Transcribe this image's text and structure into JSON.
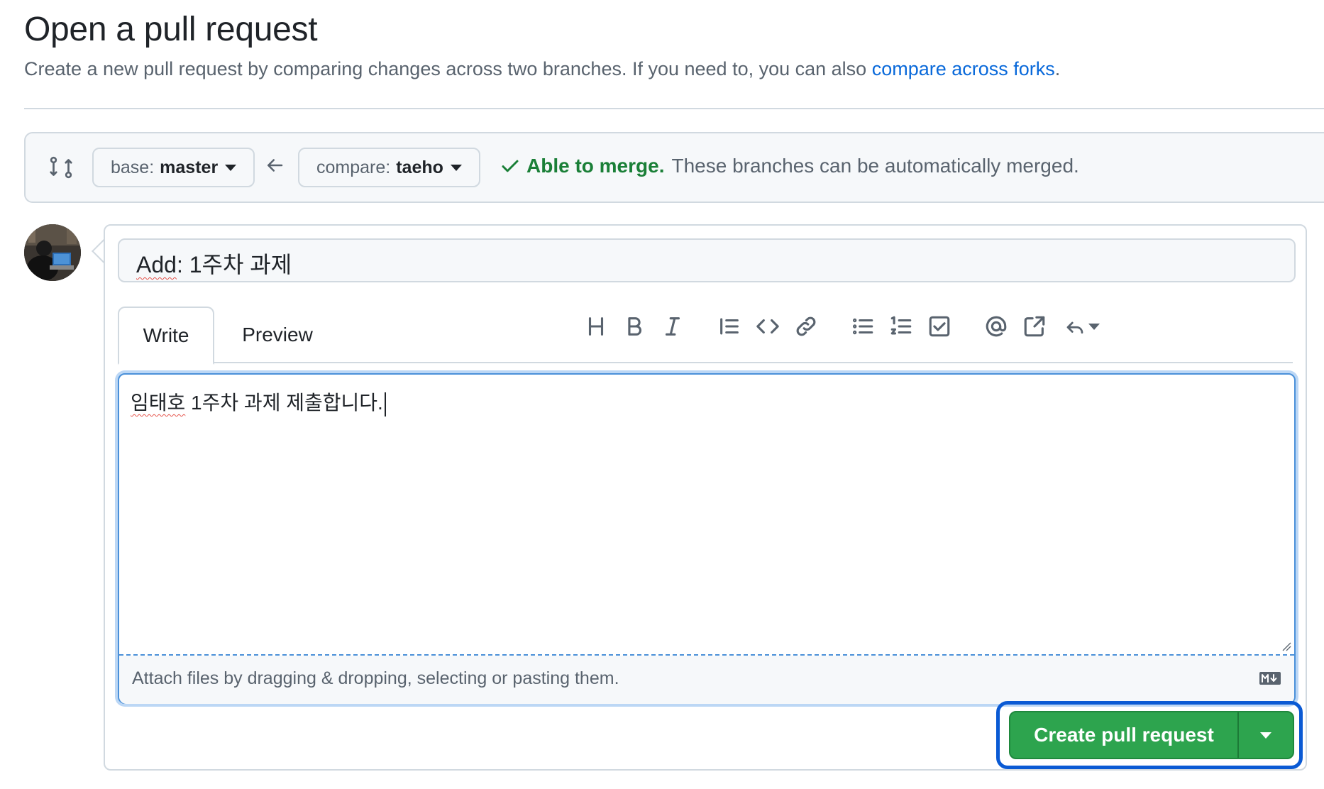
{
  "header": {
    "title": "Open a pull request",
    "subtitle_prefix": "Create a new pull request by comparing changes across two branches. If you need to, you can also ",
    "subtitle_link": "compare across forks",
    "subtitle_suffix": "."
  },
  "compare": {
    "base_label": "base:",
    "base_value": "master",
    "compare_label": "compare:",
    "compare_value": "taeho",
    "merge_ok": "Able to merge.",
    "merge_detail": "These branches can be automatically merged."
  },
  "form": {
    "title_value_prefix": "Add",
    "title_value_rest": ": 1주차 과제",
    "tabs": [
      "Write",
      "Preview"
    ],
    "toolbar": [
      "heading-icon",
      "bold-icon",
      "italic-icon",
      "quote-icon",
      "code-icon",
      "link-icon",
      "unordered-list-icon",
      "ordered-list-icon",
      "task-list-icon",
      "mention-icon",
      "reference-icon",
      "reply-icon"
    ],
    "body_misspelled": "임태호",
    "body_rest": " 1주차 과제 제출합니다.",
    "attach_text": "Attach files by dragging & dropping, selecting or pasting them."
  },
  "submit": {
    "label": "Create pull request"
  },
  "colors": {
    "accent_green": "#2da44e",
    "link_blue": "#0969da",
    "focus_blue": "#0a5ad4",
    "merge_green": "#1a7f37"
  }
}
